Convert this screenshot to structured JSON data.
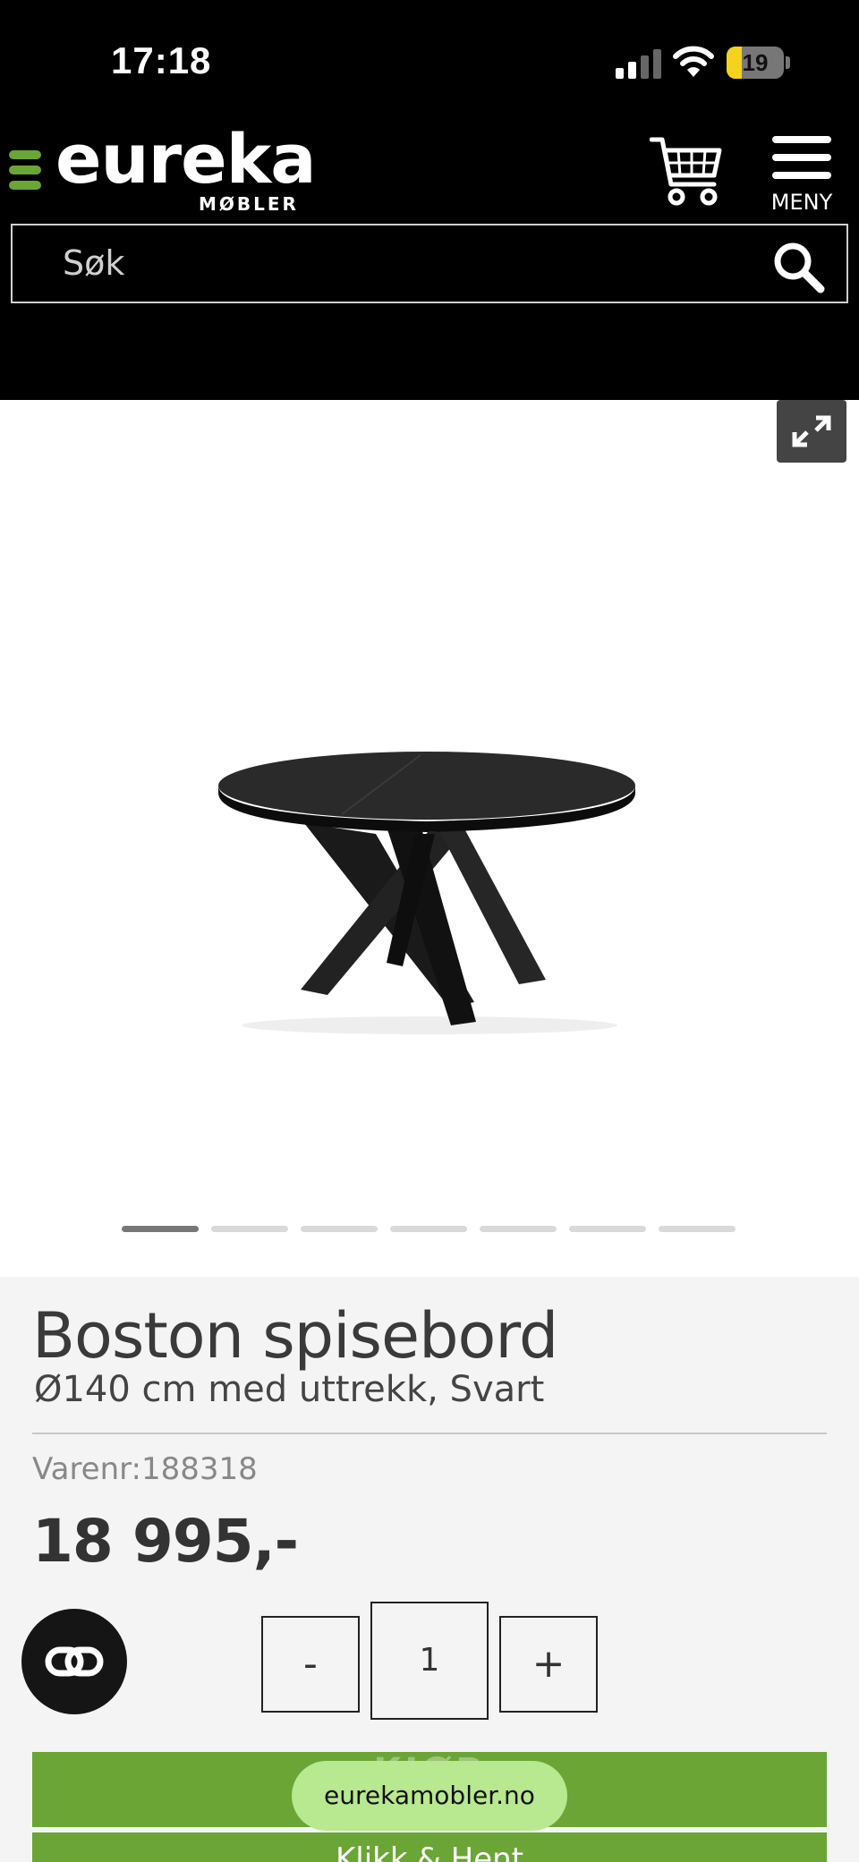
{
  "status_bar": {
    "time": "17:18",
    "battery": "19"
  },
  "header": {
    "logo": "eureka",
    "logo_sub": "MØBLER",
    "menu_label": "MENY",
    "search_placeholder": "Søk"
  },
  "gallery": {
    "image_count": 7,
    "active_index": 0
  },
  "product": {
    "title": "Boston spisebord",
    "subtitle": "Ø140 cm med uttrekk, Svart",
    "sku_label": "Varenr:",
    "sku": "188318",
    "price": "18 995,-"
  },
  "quantity": {
    "minus": "-",
    "value": "1",
    "plus": "+"
  },
  "actions": {
    "buy_ghost": "KJØP",
    "click_collect": "Klikk & Hent"
  },
  "browser": {
    "url": "eurekamobler.no"
  },
  "colors": {
    "brand_green": "#6aa535",
    "header_bg": "#000000",
    "url_pill": "#b8e88f"
  }
}
